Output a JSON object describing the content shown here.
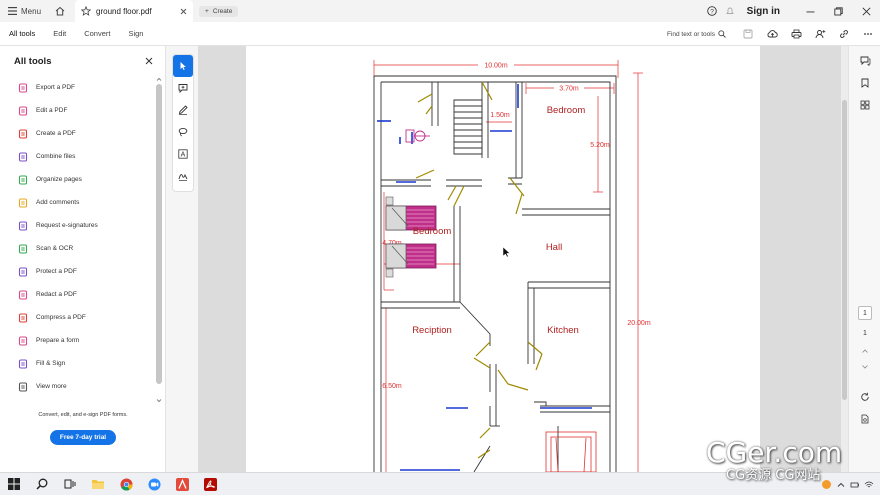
{
  "titlebar": {
    "menu_label": "Menu",
    "tab_title": "ground floor.pdf",
    "create_label": "Create",
    "signin_label": "Sign in"
  },
  "menubar": {
    "items": [
      "All tools",
      "Edit",
      "Convert",
      "Sign"
    ],
    "search_label": "Find text or tools"
  },
  "leftpanel": {
    "title": "All tools",
    "items": [
      {
        "label": "Export a PDF",
        "icon": "export-pdf-icon",
        "color": "#d84a8a"
      },
      {
        "label": "Edit a PDF",
        "icon": "edit-pdf-icon",
        "color": "#d84a8a"
      },
      {
        "label": "Create a PDF",
        "icon": "create-pdf-icon",
        "color": "#e0403a"
      },
      {
        "label": "Combine files",
        "icon": "combine-files-icon",
        "color": "#7a52c7"
      },
      {
        "label": "Organize pages",
        "icon": "organize-pages-icon",
        "color": "#3aa853"
      },
      {
        "label": "Add comments",
        "icon": "add-comments-icon",
        "color": "#e6a81e"
      },
      {
        "label": "Request e-signatures",
        "icon": "request-signatures-icon",
        "color": "#7a52c7"
      },
      {
        "label": "Scan & OCR",
        "icon": "scan-ocr-icon",
        "color": "#3aa853"
      },
      {
        "label": "Protect a PDF",
        "icon": "protect-pdf-icon",
        "color": "#7a52c7"
      },
      {
        "label": "Redact a PDF",
        "icon": "redact-pdf-icon",
        "color": "#d84a8a"
      },
      {
        "label": "Compress a PDF",
        "icon": "compress-pdf-icon",
        "color": "#e0403a"
      },
      {
        "label": "Prepare a form",
        "icon": "prepare-form-icon",
        "color": "#d84a8a"
      },
      {
        "label": "Fill & Sign",
        "icon": "fill-sign-icon",
        "color": "#7a52c7"
      },
      {
        "label": "View more",
        "icon": "view-more-icon",
        "color": "#555555"
      }
    ],
    "promo_text": "Convert, edit, and e-sign PDF forms.",
    "trial_label": "Free 7-day trial"
  },
  "drawing": {
    "dim_top": "10.00m",
    "dim_370": "3.70m",
    "dim_150": "1.50m",
    "dim_520": "5.20m",
    "dim_470": "4.70m",
    "dim_2000": "20.00m",
    "dim_650": "6.50m",
    "room_bedroom_1": "Bedroom",
    "room_bedroom_2": "Bedroom",
    "room_hall": "Hall",
    "room_reception": "Reciption",
    "room_kitchen": "Kitchen"
  },
  "rightrail": {
    "current_page": "1",
    "total_pages": "1"
  },
  "watermark": {
    "main": "CGer.com",
    "sub": "CG资源 CG网站"
  },
  "colors": {
    "accent": "#1473e6",
    "dimension_red": "#e03030",
    "room_label": "#b02020",
    "door": "#a08a00",
    "window": "#1a3ad0",
    "bed_magenta": "#c0308a"
  }
}
